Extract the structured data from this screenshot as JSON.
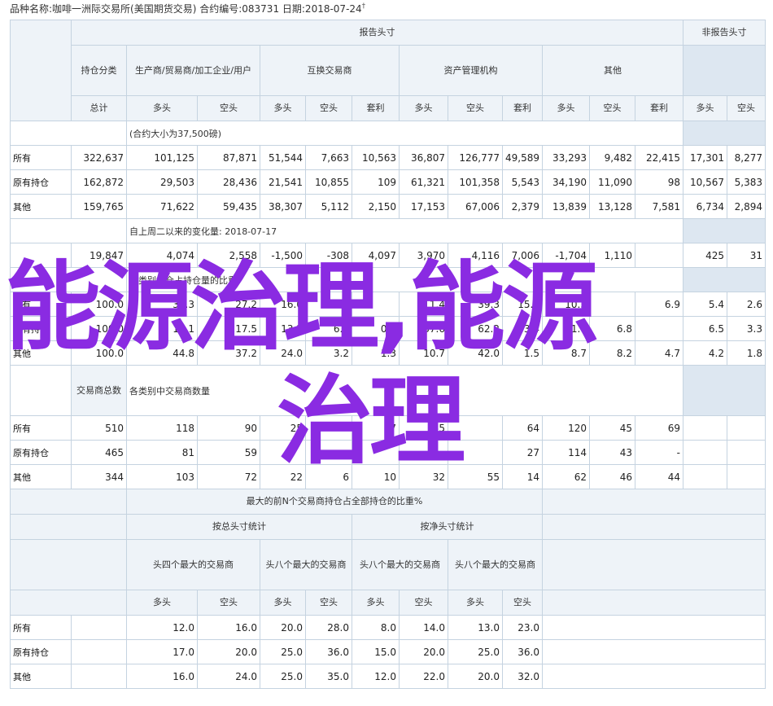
{
  "caption": {
    "text": "品种名称:咖啡一洲际交易所(美国期货交易)   合约编号:083731   日期:2018-07-24",
    "mark": "†"
  },
  "headers": {
    "reportable": "报告头寸",
    "nonreportable": "非报告头寸",
    "category": "持仓分类",
    "producer": "生产商/贸易商/加工企业/用户",
    "swap": "互换交易商",
    "managed": "资产管理机构",
    "other": "其他",
    "total": "总计",
    "long": "多头",
    "short": "空头",
    "spread": "套利"
  },
  "section1": {
    "note": "(合约大小为37,500磅)",
    "rows": [
      {
        "label": "所有",
        "values": [
          "322,637",
          "101,125",
          "87,871",
          "51,544",
          "7,663",
          "10,563",
          "36,807",
          "126,777",
          "49,589",
          "33,293",
          "9,482",
          "22,415",
          "17,301",
          "8,277"
        ]
      },
      {
        "label": "原有持仓",
        "values": [
          "162,872",
          "29,503",
          "28,436",
          "21,541",
          "10,855",
          "109",
          "61,321",
          "101,358",
          "5,543",
          "34,190",
          "11,090",
          "98",
          "10,567",
          "5,383"
        ]
      },
      {
        "label": "其他",
        "values": [
          "159,765",
          "71,622",
          "59,435",
          "38,307",
          "5,112",
          "2,150",
          "17,153",
          "67,006",
          "2,379",
          "13,839",
          "13,128",
          "7,581",
          "6,734",
          "2,894"
        ]
      }
    ]
  },
  "section2": {
    "note": "自上周二以来的变化量: 2018-07-17",
    "values": [
      "19,847",
      "4,074",
      "2,558",
      "-1,500",
      "-308",
      "4,097",
      "3,970",
      "4,116",
      "7,006",
      "-1,704",
      "1,110",
      "",
      "425",
      "31"
    ]
  },
  "section3": {
    "note": "各类别持仓占持仓量的比重",
    "rows": [
      {
        "label": "所有",
        "values": [
          "100.0",
          "31.3",
          "27.2",
          "16.0",
          "2.4",
          "",
          "11.4",
          "39.3",
          "15.4",
          "10.3",
          "",
          "6.9",
          "5.4",
          "2.6"
        ]
      },
      {
        "label": "原有持仓",
        "values": [
          "100.0",
          "18.1",
          "17.5",
          "13.2",
          "6.7",
          "0.1",
          "37.6",
          "62.2",
          "3.4",
          "21.0",
          "6.8",
          "",
          "6.5",
          "3.3"
        ]
      },
      {
        "label": "其他",
        "values": [
          "100.0",
          "44.8",
          "37.2",
          "24.0",
          "3.2",
          "1.3",
          "10.7",
          "42.0",
          "1.5",
          "8.7",
          "8.2",
          "4.7",
          "4.2",
          "1.8"
        ]
      }
    ]
  },
  "section4": {
    "traders_total": "交易商总数",
    "note": "各类别中交易商数量",
    "rows": [
      {
        "label": "所有",
        "values": [
          "510",
          "118",
          "90",
          "25",
          "",
          "17",
          "35",
          "",
          "64",
          "120",
          "45",
          "69"
        ]
      },
      {
        "label": "原有持仓",
        "values": [
          "465",
          "81",
          "59",
          "",
          "",
          "",
          "",
          "",
          "27",
          "114",
          "43",
          "-"
        ]
      },
      {
        "label": "其他",
        "values": [
          "344",
          "103",
          "72",
          "22",
          "6",
          "10",
          "32",
          "55",
          "14",
          "62",
          "46",
          "44"
        ]
      }
    ]
  },
  "section5": {
    "title": "最大的前N个交易商持仓占全部持仓的比重%",
    "gross": "按总头寸统计",
    "net": "按净头寸统计",
    "top4": "头四个最大的交易商",
    "top8": "头八个最大的交易商",
    "rows": [
      {
        "label": "所有",
        "values": [
          "12.0",
          "16.0",
          "20.0",
          "28.0",
          "8.0",
          "14.0",
          "13.0",
          "23.0"
        ]
      },
      {
        "label": "原有持仓",
        "values": [
          "17.0",
          "20.0",
          "25.0",
          "36.0",
          "15.0",
          "20.0",
          "25.0",
          "36.0"
        ]
      },
      {
        "label": "其他",
        "values": [
          "16.0",
          "24.0",
          "25.0",
          "35.0",
          "12.0",
          "22.0",
          "20.0",
          "32.0"
        ]
      }
    ]
  },
  "watermark": {
    "line1": "能源治理,能源",
    "line2": "治理"
  }
}
